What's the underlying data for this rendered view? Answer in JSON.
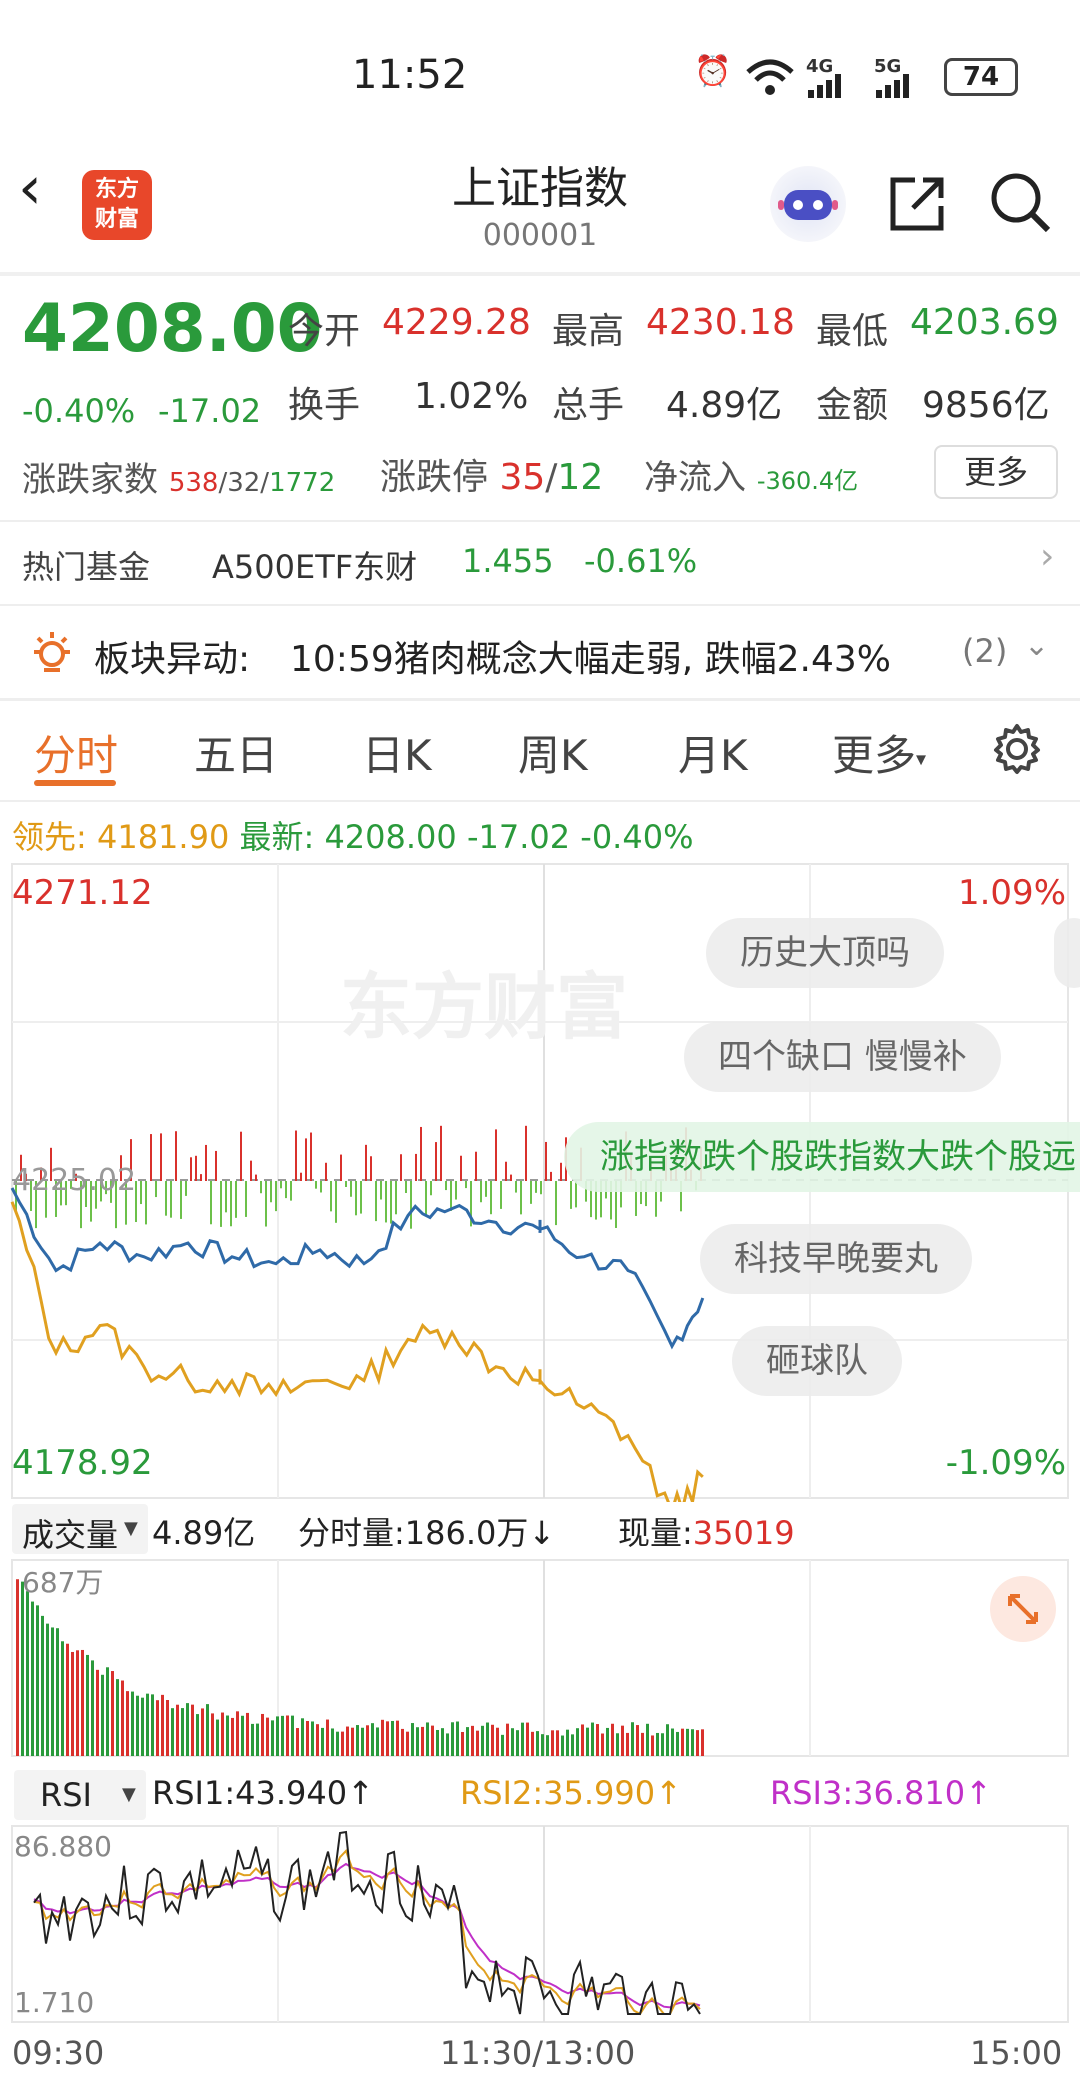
{
  "status_bar": {
    "time": "11:52",
    "battery": "74",
    "net1": "4G",
    "net2": "5G"
  },
  "header": {
    "logo": "东方\n财富",
    "title": "上证指数",
    "code": "000001"
  },
  "quote": {
    "price": "4208.00",
    "change_pct": "-0.40%",
    "change_val": "-17.02",
    "open_label": "今开",
    "open": "4229.28",
    "high_label": "最高",
    "high": "4230.18",
    "low_label": "最低",
    "low": "4203.69",
    "turnover_label": "换手",
    "turnover": "1.02%",
    "volume_label": "总手",
    "volume": "4.89亿",
    "amount_label": "金额",
    "amount": "9856亿",
    "breadth_label": "涨跌家数",
    "breadth_up": "538",
    "breadth_flat": "/32/",
    "breadth_down": "1772",
    "limit_label": "涨跌停",
    "limit_up": "35",
    "limit_sep": "/",
    "limit_down": "12",
    "netflow_label": "净流入",
    "netflow": "-360.4亿",
    "more": "更多"
  },
  "fund_row": {
    "label": "热门基金",
    "name": "A500ETF东财",
    "price": "1.455",
    "pct": "-0.61%"
  },
  "alert_row": {
    "label": "板块异动:",
    "text": "10:59猪肉概念大幅走弱, 跌幅2.43%",
    "count": "(2)"
  },
  "tabs": [
    "分时",
    "五日",
    "日K",
    "周K",
    "月K",
    "更多"
  ],
  "legend": {
    "lead_label": "领先:",
    "lead": "4181.90",
    "latest_label": "最新:",
    "latest": "4208.00",
    "chg": "-17.02",
    "pct": "-0.40%"
  },
  "main_chart": {
    "max": "4271.12",
    "min": "4178.92",
    "max_pct": "1.09%",
    "min_pct": "-1.09%",
    "ref": "4225.02",
    "watermark": "东方财富"
  },
  "bubbles": [
    "历史大顶吗",
    "四个缺口 慢慢补",
    "涨指数跌个股跌指数大跌个股远",
    "科技早晚要丸",
    "砸球队"
  ],
  "volume_bar": {
    "selector": "成交量",
    "total": "4.89亿",
    "period_label": "分时量:186.0万↓",
    "now_label": "现量:",
    "now": "35019",
    "max": "687万"
  },
  "rsi_bar": {
    "selector": "RSI",
    "rsi1": "RSI1:43.940↑",
    "rsi2": "RSI2:35.990↑",
    "rsi3": "RSI3:36.810↑",
    "max": "86.880",
    "min": "1.710"
  },
  "time_axis": {
    "start": "09:30",
    "mid": "11:30/13:00",
    "end": "15:00"
  },
  "colors": {
    "up": "#d9312c",
    "down": "#2a9a3b",
    "index_line": "#2f6aa8",
    "lead_line": "#e0a020",
    "accent": "#e8702a"
  },
  "chart_data": {
    "type": "line",
    "title": "",
    "ylim": [
      4178.92,
      4271.12
    ],
    "x_domain": [
      "09:30",
      "15:00"
    ],
    "series": [
      {
        "name": "最新",
        "x": [
          "09:30",
          "09:40",
          "09:50",
          "10:00",
          "10:10",
          "10:20",
          "10:30",
          "10:40",
          "10:50",
          "11:00",
          "11:10",
          "11:20",
          "11:30",
          "13:00",
          "13:10",
          "13:20",
          "13:30",
          "13:37"
        ],
        "values": [
          4224,
          4212,
          4216,
          4214,
          4216,
          4214,
          4213,
          4215,
          4213,
          4220,
          4221,
          4219,
          4218,
          4218,
          4214,
          4212,
          4201,
          4208
        ]
      },
      {
        "name": "领先",
        "x": [
          "09:30",
          "09:40",
          "09:50",
          "10:00",
          "10:10",
          "10:20",
          "10:30",
          "10:40",
          "10:50",
          "11:00",
          "11:10",
          "11:20",
          "11:30",
          "13:00",
          "13:10",
          "13:20",
          "13:30",
          "13:37"
        ],
        "values": [
          4222,
          4200,
          4204,
          4198,
          4196,
          4196,
          4194,
          4196,
          4196,
          4202,
          4203,
          4198,
          4196,
          4196,
          4192,
          4188,
          4177,
          4182
        ]
      }
    ]
  }
}
